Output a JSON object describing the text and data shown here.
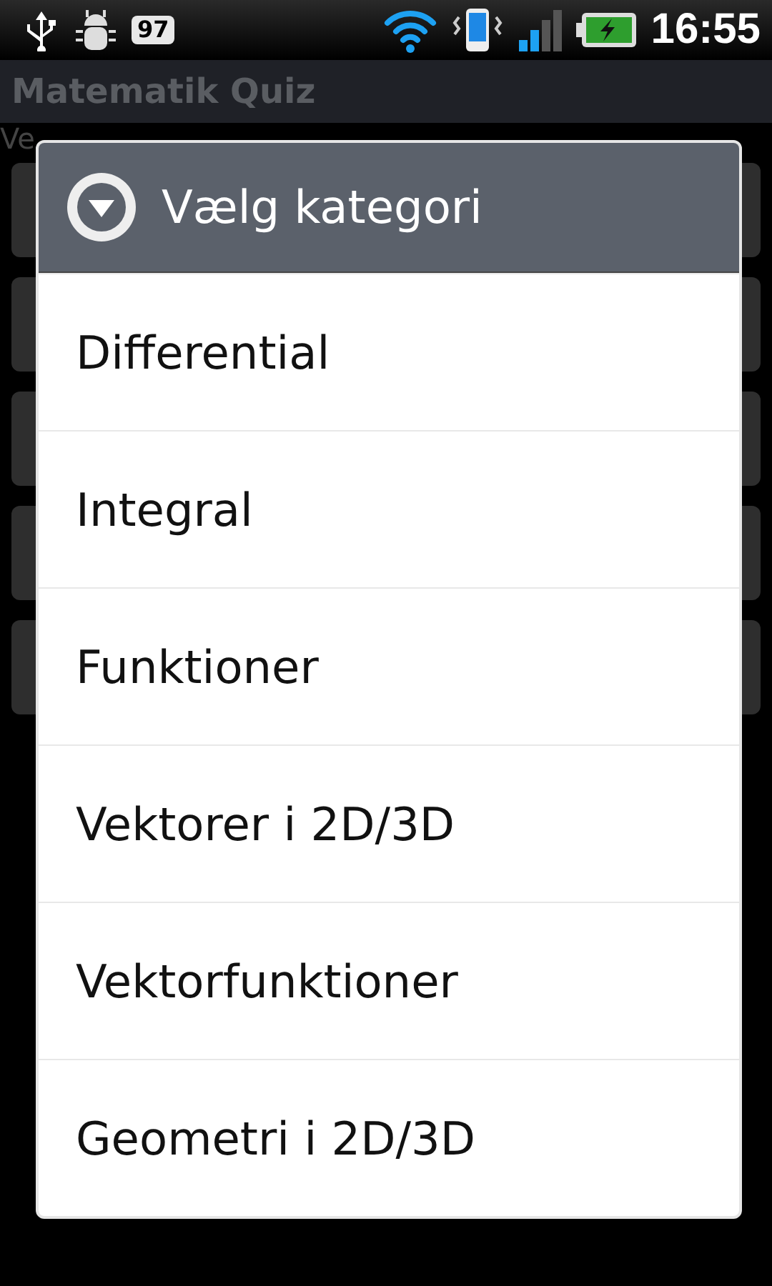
{
  "status_bar": {
    "notification_badge": "97",
    "time": "16:55"
  },
  "app": {
    "title": "Matematik Quiz",
    "hint": "Ve",
    "buttons": [
      {
        "kind": "blank"
      },
      {
        "kind": "blank"
      },
      {
        "kind": "blank"
      },
      {
        "kind": "blank"
      },
      {
        "kind": "blank"
      }
    ]
  },
  "dialog": {
    "title": "Vælg kategori",
    "items": [
      {
        "label": "Differential"
      },
      {
        "label": "Integral"
      },
      {
        "label": "Funktioner"
      },
      {
        "label": "Vektorer i 2D/3D"
      },
      {
        "label": "Vektorfunktioner"
      },
      {
        "label": "Geometri i 2D/3D"
      }
    ]
  }
}
